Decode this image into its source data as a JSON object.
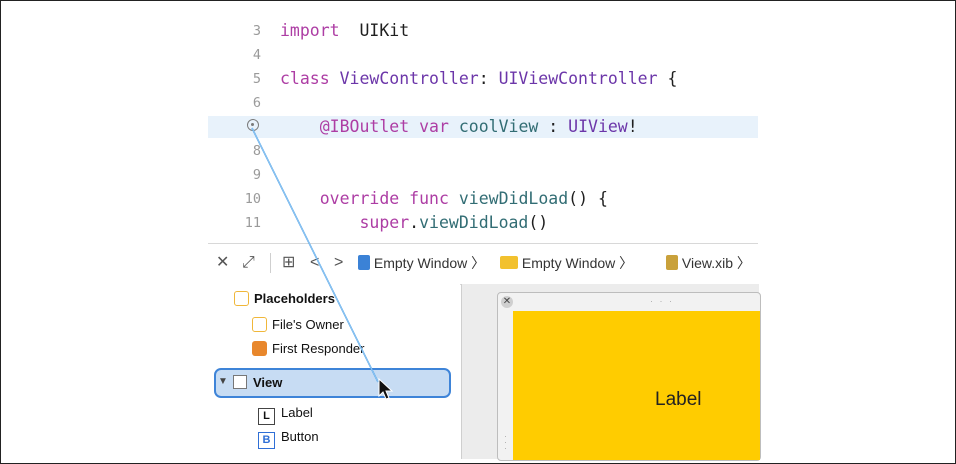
{
  "code_lines": [
    {
      "num": "3",
      "tokens": [
        [
          "kw",
          "import"
        ],
        [
          "",
          "  UIKit"
        ]
      ]
    },
    {
      "num": "4",
      "tokens": []
    },
    {
      "num": "5",
      "tokens": [
        [
          "kw",
          "class"
        ],
        [
          "",
          " "
        ],
        [
          "ty",
          "ViewController"
        ],
        [
          "",
          ": "
        ],
        [
          "ty",
          "UIViewController"
        ],
        [
          "",
          " {"
        ]
      ]
    },
    {
      "num": "6",
      "tokens": []
    },
    {
      "num": "",
      "tokens": [
        [
          "",
          "    "
        ],
        [
          "kw",
          "@IBOutlet"
        ],
        [
          "",
          " "
        ],
        [
          "kw",
          "var"
        ],
        [
          "",
          " "
        ],
        [
          "fn",
          "coolView"
        ],
        [
          "",
          " : "
        ],
        [
          "ty",
          "UIView"
        ],
        [
          "",
          "!"
        ]
      ],
      "outlet": true
    },
    {
      "num": "8",
      "tokens": []
    },
    {
      "num": "9",
      "tokens": []
    },
    {
      "num": "10",
      "tokens": [
        [
          "",
          "    "
        ],
        [
          "kw",
          "override"
        ],
        [
          "",
          " "
        ],
        [
          "kw",
          "func"
        ],
        [
          "",
          " "
        ],
        [
          "fn",
          "viewDidLoad"
        ],
        [
          "",
          "() {"
        ]
      ]
    },
    {
      "num": "11",
      "tokens": [
        [
          "",
          "        "
        ],
        [
          "kw",
          "super"
        ],
        [
          "",
          "."
        ],
        [
          "fn",
          "viewDidLoad"
        ],
        [
          "",
          "()"
        ]
      ]
    }
  ],
  "jumpbar": {
    "close_icon": "✕",
    "expand_icon": "⤢",
    "grid_icon": "⊞",
    "back_icon": "<",
    "forward_icon": ">",
    "crumb1": "Empty Window",
    "crumb2": "Empty Window",
    "crumb3": "View.xib",
    "chev": "〉"
  },
  "outline": {
    "placeholders": "Placeholders",
    "files_owner": "File's Owner",
    "first_responder": "First Responder",
    "view": "View",
    "label_item": "Label",
    "button_item": "Button",
    "label_letter": "L",
    "button_letter": "B"
  },
  "canvas": {
    "label_text": "Label",
    "close_glyph": "✕",
    "dots": "· · ·"
  }
}
